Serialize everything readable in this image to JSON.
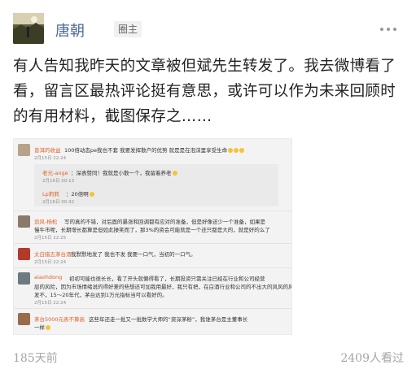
{
  "author": {
    "name": "唐朝",
    "badge": "圈主"
  },
  "post": {
    "text": "有人告知我昨天的文章被但斌先生转发了。我去微博看了看，留言区最热评论挺有意思，或许可以作为未来回顾时的有用材料，截图保存之……"
  },
  "screenshot": {
    "comments": [
      {
        "name": "普洱的收益",
        "text": "100倍动态pe我也不套 我要发挥散户的优势 就是是在泡沫里享受生命",
        "date": "2月15日 22:24",
        "color": "#b7a38a"
      },
      {
        "name": "追风-杨松",
        "text": "写的真的不错，对后面的暴涨和回调都有应对的准备，但是好像还少一个准备，如果是",
        "text2": "慢牛市呢，长期增长都算是但如此操笑而了，那3%的资会可能就是一个还只都是大的，就是好的么了",
        "date": "2月15日 22:25",
        "color": "#8a7a6a"
      },
      {
        "name": "太白猎五茅台酒",
        "text": "我默默地发了 我也不发 我要一口气，当初的一口气。",
        "date": "2月15日 22:24",
        "color": "#b23a2a"
      },
      {
        "name": "aiaohdong",
        "text": "初初可能也很长长，看了开头就懒得看了，长期投资只需关注已经在行业和公司经营",
        "text2": "层的风险，因为市场情绪说的得好差的些想还可加我用最好，我只有把，在白酒行业和公司的不出大的风风的风风",
        "text3": "发不，15～20年代，茅台达到1万元指标当可以看好的。",
        "date": "2月15日 22:24",
        "color": "#6d7a80"
      },
      {
        "name": "茅台5000元表不算高",
        "text": "这些年还走一批又一批数学大师的“资深茅粉”，我谁茅台是主董事长",
        "text2": "一样",
        "date": "",
        "color": "#9a6b4a"
      }
    ],
    "replies": [
      {
        "name": "老元-ange",
        "text": "：深表赞同！我就是小散一个，我留着养老",
        "date": "2月16日 00:13"
      },
      {
        "name": "Lp莉莉",
        "text": "：20倍啊",
        "date": "2月16日 00:32"
      }
    ]
  },
  "footer": {
    "ago": "185天前",
    "views": "2409人看过"
  }
}
